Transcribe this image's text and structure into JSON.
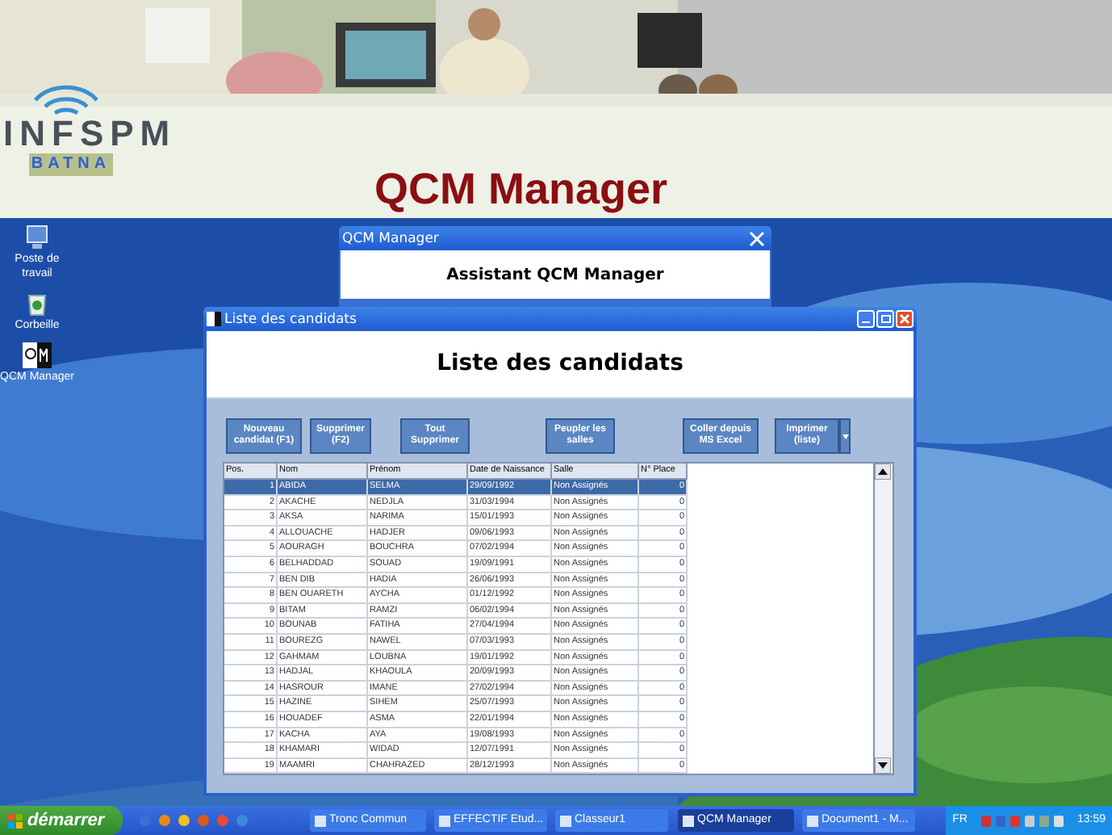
{
  "slide": {
    "logo": {
      "name": "INFSPM",
      "city": "BATNA"
    },
    "title": "QCM Manager"
  },
  "desktop_icons": [
    {
      "label": "Poste de travail",
      "kind": "computer"
    },
    {
      "label": "Corbeille",
      "kind": "bin"
    },
    {
      "label": "QCM Manager",
      "kind": "app"
    }
  ],
  "back_window": {
    "title": "QCM Manager",
    "heading": "Assistant QCM Manager"
  },
  "window": {
    "title": "Liste des candidats",
    "heading": "Liste des candidats",
    "buttons": [
      {
        "label": "Nouveau candidat (F1)",
        "kind": "plain"
      },
      {
        "label": "Supprimer (F2)",
        "kind": "plain"
      },
      {
        "label": "Tout Supprimer",
        "kind": "plain"
      },
      {
        "label": "Peupler les salles",
        "kind": "plain"
      },
      {
        "label": "Coller depuis MS Excel",
        "kind": "plain"
      },
      {
        "label": "Imprimer (liste)",
        "kind": "split"
      }
    ],
    "table": {
      "columns": [
        "Pos.",
        "Nom",
        "Prénom",
        "Date de Naissance",
        "Salle",
        "N° Place"
      ],
      "rows": [
        {
          "cells": [
            "1",
            "ABIDA",
            "SELMA",
            "29/09/1992",
            "Non Assignés",
            "0"
          ],
          "selected": true
        },
        {
          "cells": [
            "2",
            "AKACHE",
            "NEDJLA",
            "31/03/1994",
            "Non Assignés",
            "0"
          ],
          "selected": false
        },
        {
          "cells": [
            "3",
            "AKSA",
            "NARIMA",
            "15/01/1993",
            "Non Assignés",
            "0"
          ],
          "selected": false
        },
        {
          "cells": [
            "4",
            "ALLOUACHE",
            "HADJER",
            "09/06/1993",
            "Non Assignés",
            "0"
          ],
          "selected": false
        },
        {
          "cells": [
            "5",
            "AOURAGH",
            "BOUCHRA",
            "07/02/1994",
            "Non Assignés",
            "0"
          ],
          "selected": false
        },
        {
          "cells": [
            "6",
            "BELHADDAD",
            "SOUAD",
            "19/09/1991",
            "Non Assignés",
            "0"
          ],
          "selected": false
        },
        {
          "cells": [
            "7",
            "BEN DIB",
            "HADIA",
            "26/06/1993",
            "Non Assignés",
            "0"
          ],
          "selected": false
        },
        {
          "cells": [
            "8",
            "BEN OUARETH",
            "AYCHA",
            "01/12/1992",
            "Non Assignés",
            "0"
          ],
          "selected": false
        },
        {
          "cells": [
            "9",
            "BITAM",
            "RAMZI",
            "06/02/1994",
            "Non Assignés",
            "0"
          ],
          "selected": false
        },
        {
          "cells": [
            "10",
            "BOUNAB",
            "FATIHA",
            "27/04/1994",
            "Non Assignés",
            "0"
          ],
          "selected": false
        },
        {
          "cells": [
            "11",
            "BOUREZG",
            "NAWEL",
            "07/03/1993",
            "Non Assignés",
            "0"
          ],
          "selected": false
        },
        {
          "cells": [
            "12",
            "GAHMAM",
            "LOUBNA",
            "19/01/1992",
            "Non Assignés",
            "0"
          ],
          "selected": false
        },
        {
          "cells": [
            "13",
            "HADJAL",
            "KHAOULA",
            "20/09/1993",
            "Non Assignés",
            "0"
          ],
          "selected": false
        },
        {
          "cells": [
            "14",
            "HASROUR",
            "IMANE",
            "27/02/1994",
            "Non Assignés",
            "0"
          ],
          "selected": false
        },
        {
          "cells": [
            "15",
            "HAZINE",
            "SIHEM",
            "25/07/1993",
            "Non Assignés",
            "0"
          ],
          "selected": false
        },
        {
          "cells": [
            "16",
            "HOUADEF",
            "ASMA",
            "22/01/1994",
            "Non Assignés",
            "0"
          ],
          "selected": false
        },
        {
          "cells": [
            "17",
            "KACHA",
            "AYA",
            "19/08/1993",
            "Non Assignés",
            "0"
          ],
          "selected": false
        },
        {
          "cells": [
            "18",
            "KHAMARI",
            "WIDAD",
            "12/07/1991",
            "Non Assignés",
            "0"
          ],
          "selected": false
        },
        {
          "cells": [
            "19",
            "MAAMRI",
            "CHAHRAZED",
            "28/12/1993",
            "Non Assignés",
            "0"
          ],
          "selected": false
        }
      ]
    }
  },
  "taskbar": {
    "start": "démarrer",
    "tasks": [
      {
        "label": "Tronc Commun",
        "selected": false
      },
      {
        "label": "EFFECTIF Etud...",
        "selected": false
      },
      {
        "label": "Classeur1",
        "selected": false
      },
      {
        "label": "QCM Manager",
        "selected": true
      },
      {
        "label": "Document1 - M...",
        "selected": false
      }
    ],
    "language": "FR",
    "clock": "13:59"
  }
}
